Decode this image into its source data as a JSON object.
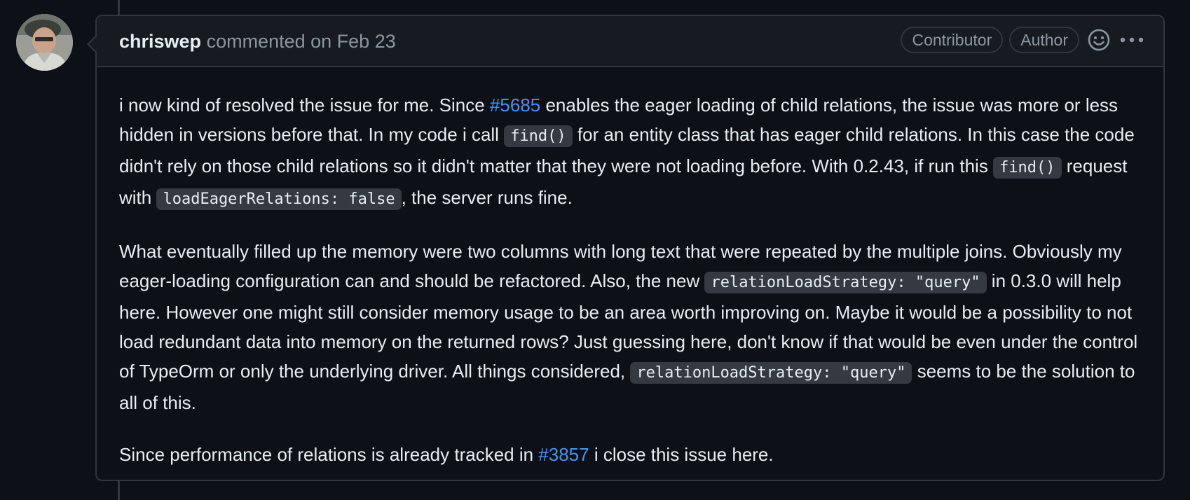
{
  "comment": {
    "author": "chriswep",
    "meta_text": "commented on Feb 23",
    "badges": [
      "Contributor",
      "Author"
    ],
    "icons": {
      "reaction": "smiley-icon",
      "more": "kebab-horizontal-icon"
    },
    "colors": {
      "background": "#0d1117",
      "header_bg": "#161b22",
      "border": "#30363d",
      "link": "#4493f8",
      "code_bg": "#343942"
    },
    "paragraphs": {
      "p1": {
        "t1": "i now kind of resolved the issue for me. Since ",
        "link1": "#5685",
        "t2": " enables the eager loading of child relations, the issue was more or less hidden in versions before that. In my code i call ",
        "code1": "find()",
        "t3": " for an entity class that has eager child relations. In this case the code didn't rely on those child relations so it didn't matter that they were not loading before. With 0.2.43, if run this ",
        "code2": "find()",
        "t4": " request with ",
        "code3": "loadEagerRelations: false",
        "t5": ", the server runs fine."
      },
      "p2": {
        "t1": "What eventually filled up the memory were two columns with long text that were repeated by the multiple joins. Obviously my eager-loading configuration can and should be refactored. Also, the new ",
        "code1": "relationLoadStrategy: \"query\"",
        "t2": " in 0.3.0 will help here. However one might still consider memory usage to be an area worth improving on. Maybe it would be a possibility to not load redundant data into memory on the returned rows? Just guessing here, don't know if that would be even under the control of TypeOrm or only the underlying driver. All things considered, ",
        "code2": "relationLoadStrategy: \"query\"",
        "t3": " seems to be the solution to all of this."
      },
      "p3": {
        "t1": "Since performance of relations is already tracked in ",
        "link1": "#3857",
        "t2": " i close this issue here."
      }
    }
  }
}
